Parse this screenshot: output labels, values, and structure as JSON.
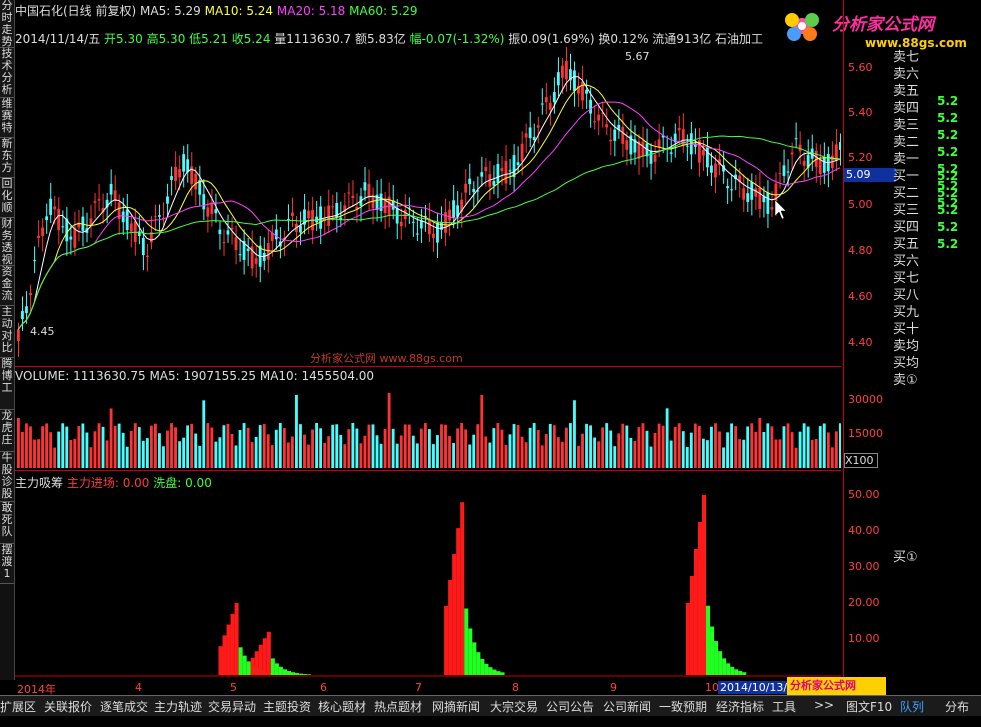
{
  "left_tabs": [
    "分时走势",
    "技术分析",
    "维赛特",
    "新东方",
    "回化顺",
    "财务透视",
    "资金流",
    "主动对比",
    "腾博工",
    "龙虎庄",
    "牛股诊股",
    "敢死队",
    "摆渡1"
  ],
  "header": {
    "stock_name": "中国石化(日线 前复权)",
    "ma5": "MA5: 5.29",
    "ma10": "MA10: 5.24",
    "ma20": "MA20: 5.18",
    "ma60": "MA60: 5.29",
    "date": "2014/11/14/五",
    "open": "开5.30",
    "high": "高5.30",
    "low": "低5.21",
    "close": "收5.24",
    "volume": "量1113630.7",
    "amount": "额5.83亿",
    "change": "幅-0.07(-1.32%)",
    "amplitude": "振0.09(1.69%)",
    "turnover": "换0.12%",
    "float": "流通913亿",
    "industry": "石油加工"
  },
  "logo": {
    "text": "分析家公式网",
    "url": "www.88gs.com"
  },
  "watermark": "分析家公式网 www.88gs.com",
  "price_axis": [
    "5.60",
    "5.40",
    "5.20",
    "5.00",
    "4.80",
    "4.60",
    "4.40"
  ],
  "current_price_tag": "5.09",
  "peak_label": "5.67",
  "trough_label": "4.45",
  "volume_header": "VOLUME: 1113630.75  MA5: 1907155.25  MA10: 1455504.00",
  "volume_axis": [
    "30000",
    "15000"
  ],
  "volume_unit": "X100",
  "indicator_header": {
    "name": "主力吸筹",
    "in_label": "主力进场: 0.00",
    "out_label": "洗盘: 0.00"
  },
  "indicator_axis": [
    "50.00",
    "40.00",
    "30.00",
    "20.00",
    "10.00"
  ],
  "order_book": {
    "sell_labels": [
      "卖七",
      "卖六",
      "卖五",
      "卖四",
      "卖三",
      "卖二",
      "卖一"
    ],
    "sell_values": [
      "5.2",
      "5.2",
      "5.2",
      "5.2",
      "5.2",
      "5.2",
      "5.2"
    ],
    "buy_labels": [
      "买一",
      "买二",
      "买三",
      "买四",
      "买五",
      "买六",
      "买七",
      "买八",
      "买九",
      "买十",
      "卖均",
      "买均",
      "卖①"
    ],
    "buy_values": [
      "5.2",
      "5.2",
      "5.2",
      "5.2",
      "5.2"
    ],
    "buy_marker": "买①"
  },
  "date_axis": [
    "2014年",
    "4",
    "5",
    "6",
    "7",
    "8",
    "9",
    "10"
  ],
  "date_highlight": "2014/10/13/",
  "bottom_tabs": [
    "扩展区",
    "关联报价",
    "逐笔成交",
    "主力轨迹",
    "交易异动",
    "主题投资",
    "核心题材",
    "热点题材",
    "网摘新闻",
    "大宗交易",
    "公司公告",
    "公司新闻",
    "一致预期",
    "经济指标",
    "工具",
    ">>",
    "图文F10",
    "队列",
    "分布"
  ],
  "footer_watermark": "分析家公式网 www.88gs.com",
  "colors": {
    "up": "#ff3333",
    "down": "#44ffff",
    "ma5": "#ffffff",
    "ma10": "#ffff40",
    "ma20": "#ff40ff",
    "ma60": "#40ff40"
  }
}
